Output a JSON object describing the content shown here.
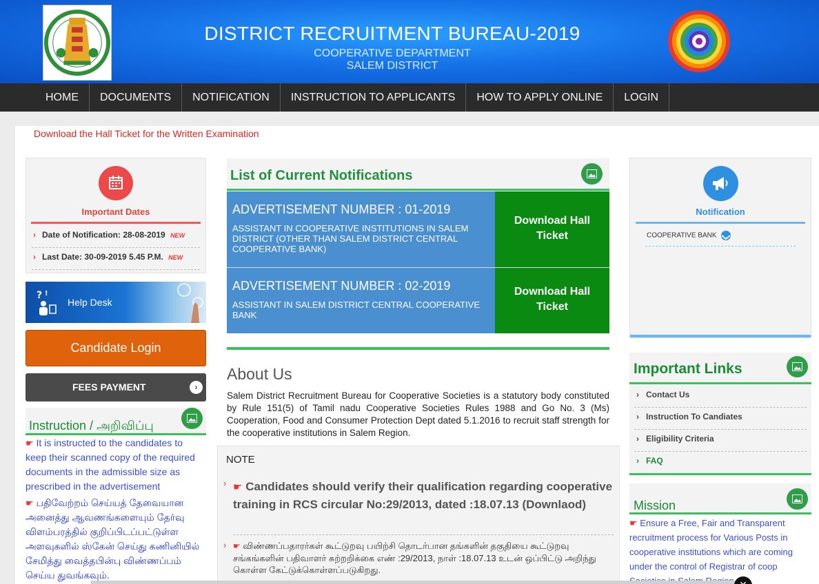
{
  "header": {
    "title": "DISTRICT RECRUITMENT BUREAU-2019",
    "subtitle1": "COOPERATIVE DEPARTMENT",
    "subtitle2": "SALEM DISTRICT",
    "colors": {
      "header_blue": "#1672e8",
      "nav_dark": "#2b2b2b"
    }
  },
  "nav": {
    "items": [
      "HOME",
      "DOCUMENTS",
      "NOTIFICATION",
      "INSTRUCTION TO APPLICANTS",
      "HOW TO APPLY ONLINE",
      "LOGIN"
    ]
  },
  "marquee": "Download the Hall Ticket for the Written Examination",
  "important_dates": {
    "title": "Important Dates",
    "icon": "calendar-icon",
    "items": [
      {
        "text": "Date of Notification: 28-08-2019",
        "badge": "NEW"
      },
      {
        "text": "Last Date: 30-09-2019 5.45 P.M.",
        "badge": "NEW"
      }
    ]
  },
  "helpdesk": {
    "label": "Help Desk"
  },
  "candidate_login": {
    "label": "Candidate Login"
  },
  "fees_payment": {
    "label": "FEES PAYMENT"
  },
  "instruction": {
    "title": "Instruction / அறிவிப்பு",
    "en": "It is instructed to the candidates to keep their scanned copy of the required documents in the admissible size as prescribed in the advertisement",
    "ta": "பதிவேற்றம் செய்யத் தேவையான அனைத்து ஆவணங்களையும் தேர்வு விளம்பரத்தில் குறிப்பிடப்பட்டுள்ள அளவுகளில் ஸ்கேன் செய்து கணினியில் சேமித்து வைத்தபின்பு விண்ணப்பம் செய்ய துவங்கவும்."
  },
  "notifications": {
    "title": "List of Current Notifications",
    "items": [
      {
        "heading": "ADVERTISEMENT NUMBER : 01-2019",
        "desc": "ASSISTANT IN COOPERATIVE INSTITUTIONS IN SALEM DISTRICT (OTHER THAN SALEM DISTRICT CENTRAL COOPERATIVE BANK)",
        "button": "Download Hall Ticket"
      },
      {
        "heading": "ADVERTISEMENT NUMBER : 02-2019",
        "desc": "ASSISTANT IN SALEM DISTRICT CENTRAL COOPERATIVE BANK",
        "button": "Download Hall Ticket"
      }
    ]
  },
  "about": {
    "title": "About Us",
    "text": "Salem District Recruitment Bureau for Cooperative Societies is a statutory body constituted by Rule 151(5) of Tamil nadu Cooperative Societies Rules 1988 and Go No. 3 (Ms) Cooperation, Food and Consumer Protection Dept dated 5.1.2016 to recruit staff strength for the cooperative institutions in Salem Region."
  },
  "note": {
    "title": "NOTE",
    "item1": "Candidates should verify their qualification regarding cooperative training in RCS circular No:29/2013, dated :18.07.13 (Downlaod)",
    "item2": "விண்ணப்பதாரர்கள் கூட்டுறவு பயிற்சி தொடர்பான தங்களின் தகுதியை கூட்டுறவு சங்கங்களின் பதிவாளர் சுற்றறிக்கை எண் :29/2013, நாள் :18.07.13 உடன் ஒப்பிட்டு அறிந்து கொள்ள கேட்டுக்கொள்ளப்படுகிறது."
  },
  "notification_panel": {
    "title": "Notification",
    "icon": "megaphone-icon",
    "items": [
      "COOPERATIVE BANK"
    ]
  },
  "important_links": {
    "title": "Important Links",
    "items": [
      "Contact Us",
      "Instruction To Candiates",
      "Eligibility Criteria",
      "FAQ"
    ]
  },
  "mission": {
    "title": "Mission",
    "text": "Ensure a Free, Fair and Transparent recruitment process for Various Posts in cooperative institutions which are coming under the control of Registrar of coop Societies in Salem Region"
  }
}
